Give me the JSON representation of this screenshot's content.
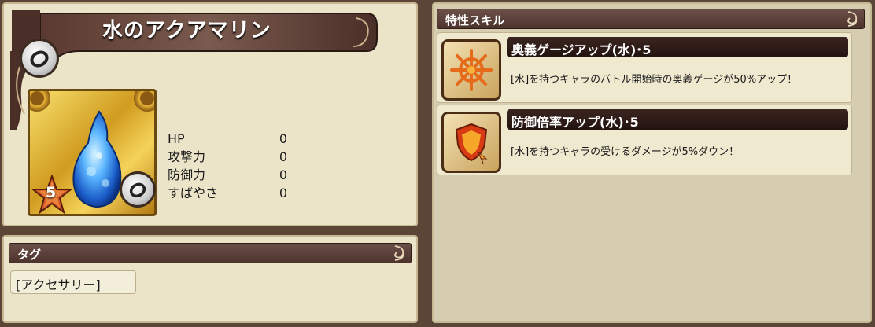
{
  "item": {
    "name": "水のアクアマリン",
    "rarity": "5",
    "stats": [
      {
        "label": "HP",
        "value": "0"
      },
      {
        "label": "攻撃力",
        "value": "0"
      },
      {
        "label": "防御力",
        "value": "0"
      },
      {
        "label": "すばやさ",
        "value": "0"
      }
    ]
  },
  "tags": {
    "header": "タグ",
    "items": [
      "[アクセサリー]"
    ]
  },
  "skills": {
    "header": "特性スキル",
    "items": [
      {
        "name": "奥義ゲージアップ(水)･5",
        "description": "[水]を持つキャラのバトル開始時の奥義ゲージが50%アップ！",
        "icon": "ougi-gauge-icon"
      },
      {
        "name": "防御倍率アップ(水)･5",
        "description": "[水]を持つキャラの受けるダメージが5%ダウン！",
        "icon": "defense-shield-icon"
      }
    ]
  },
  "colors": {
    "panel": "#ebe4c9",
    "background": "#5a4536",
    "header": "#4c342d"
  }
}
